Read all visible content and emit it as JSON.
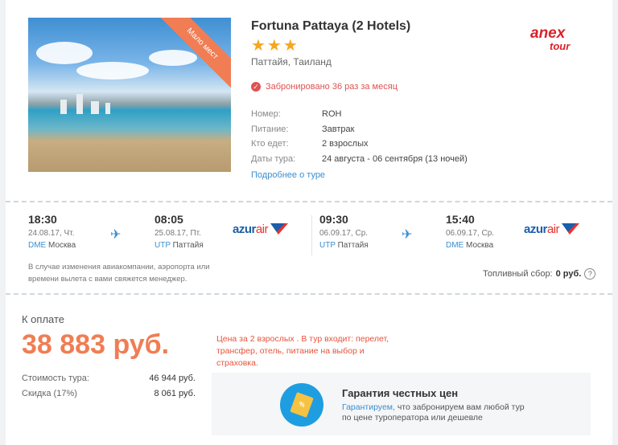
{
  "hotel": {
    "name": "Fortuna Pattaya (2 Hotels)",
    "stars": "★★★",
    "location": "Паттайя, Таиланд",
    "ribbon": "Мало мест",
    "booked": "Забронировано 36 раз за месяц",
    "details": [
      {
        "key": "Номер:",
        "value": "ROH"
      },
      {
        "key": "Питание:",
        "value": "Завтрак"
      },
      {
        "key": "Кто едет:",
        "value": "2 взрослых"
      },
      {
        "key": "Даты тура:",
        "value": "24 августа - 06 сентября (13 ночей)"
      }
    ],
    "more_link": "Подробнее о туре"
  },
  "operator": {
    "logo_top": "anex",
    "logo_bottom": "tour"
  },
  "flights": {
    "outbound": {
      "depart": {
        "time": "18:30",
        "date": "24.08.17, Чт.",
        "airport": "DME",
        "city": "Москва"
      },
      "arrive": {
        "time": "08:05",
        "date": "25.08.17, Пт.",
        "airport": "UTP",
        "city": "Паттайя"
      },
      "airline": {
        "name": "azur",
        "suffix": "air"
      }
    },
    "return": {
      "depart": {
        "time": "09:30",
        "date": "06.09.17, Ср.",
        "airport": "UTP",
        "city": "Паттайя"
      },
      "arrive": {
        "time": "15:40",
        "date": "06.09.17, Ср.",
        "airport": "DME",
        "city": "Москва"
      },
      "airline": {
        "name": "azur",
        "suffix": "air"
      }
    },
    "notice": "В случае изменения авиакомпании, аэропорта или времени вылета с вами свяжется менеджер.",
    "fuel_label": "Топливный сбор:",
    "fuel_value": "0 руб.",
    "fuel_help": "?"
  },
  "pricing": {
    "label": "К оплате",
    "total": "38 883 руб.",
    "rows": [
      {
        "key": "Стоимость тура:",
        "value": "46 944 руб."
      },
      {
        "key": "Скидка (17%)",
        "value": "8 061 руб."
      }
    ],
    "note": "Цена за 2 взрослых . В тур входит: перелет, трансфер, отель, питание на выбор и страховка."
  },
  "guarantee": {
    "title": "Гарантия честных цен",
    "link": "Гарантируем,",
    "text": " что забронируем вам любой тур по цене туроператора или дешевле",
    "tag": "%"
  },
  "colors": {
    "accent": "#f07d54",
    "link": "#3a8fd0",
    "alert": "#e05252",
    "star": "#f5a623"
  }
}
